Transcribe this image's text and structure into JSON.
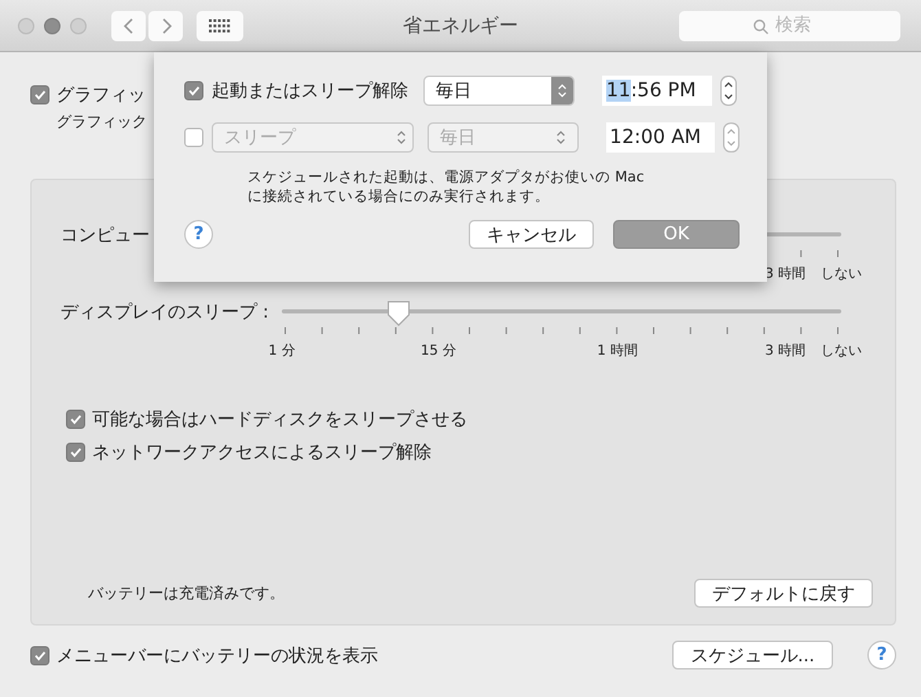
{
  "window": {
    "title": "省エネルギー",
    "search_placeholder": "検索"
  },
  "graphics": {
    "label": "グラフィッ",
    "checked": true,
    "note": "グラフィック"
  },
  "panel": {
    "sliders": [
      {
        "label": "コンピュー",
        "ticks": [
          "3 時間",
          "しない"
        ]
      },
      {
        "label": "ディスプレイのスリープ :",
        "level": 0.21,
        "ticks": [
          "1 分",
          "15 分",
          "1 時間",
          "3 時間",
          "しない"
        ]
      }
    ],
    "options": [
      {
        "label": "可能な場合はハードディスクをスリープさせる",
        "checked": true
      },
      {
        "label": "ネットワークアクセスによるスリープ解除",
        "checked": true
      }
    ],
    "battery_status": "バッテリーは充電済みです。",
    "default_button": "デフォルトに戻す"
  },
  "menu_bar_option": {
    "label": "メニューバーにバッテリーの状況を表示",
    "checked": true
  },
  "schedule_button": "スケジュール...",
  "help_button": "?",
  "sheet": {
    "rows": [
      {
        "checked": true,
        "event": {
          "kind": "label",
          "text": "起動またはスリープ解除"
        },
        "frequency": "毎日",
        "time_parts": [
          {
            "text": "11",
            "selected": true
          },
          {
            "text": ":56 PM",
            "selected": false
          }
        ]
      },
      {
        "checked": false,
        "event": {
          "kind": "popup",
          "text": "スリープ"
        },
        "frequency": "毎日",
        "time_parts": [
          {
            "text": "12:00 AM",
            "selected": false
          }
        ]
      }
    ],
    "note": "スケジュールされた起動は、電源アダプタがお使いの Mac に接続されている場合にのみ実行されます。",
    "help_button": "?",
    "cancel_button": "キャンセル",
    "ok_button": "OK"
  }
}
